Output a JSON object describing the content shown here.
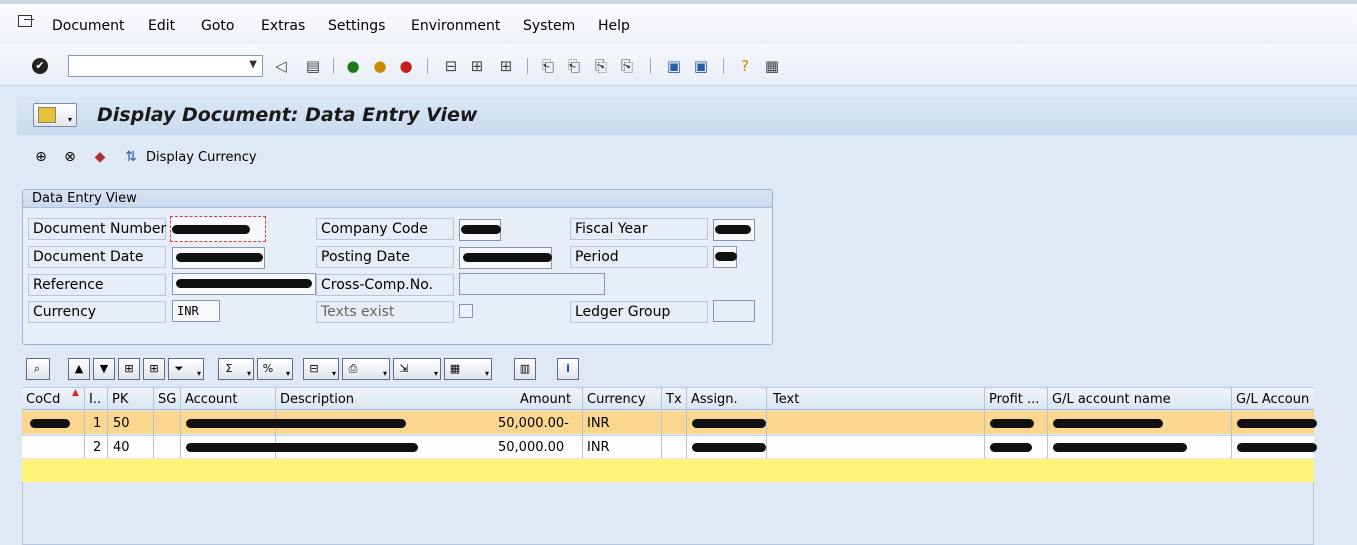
{
  "menu": {
    "items": [
      {
        "label": "Document"
      },
      {
        "label": "Edit"
      },
      {
        "label": "Goto"
      },
      {
        "label": "Extras"
      },
      {
        "label": "Settings"
      },
      {
        "label": "Environment"
      },
      {
        "label": "System"
      },
      {
        "label": "Help"
      }
    ]
  },
  "command_field": {
    "value": ""
  },
  "page": {
    "title": "Display Document: Data Entry View"
  },
  "app_toolbar": {
    "display_currency_label": "Display Currency"
  },
  "groupbox": {
    "title": "Data Entry View",
    "document_number_label": "Document Number",
    "document_date_label": "Document Date",
    "reference_label": "Reference",
    "currency_label": "Currency",
    "currency_value": "INR",
    "company_code_label": "Company Code",
    "posting_date_label": "Posting Date",
    "cross_comp_label": "Cross-Comp.No.",
    "texts_exist_label": "Texts exist",
    "fiscal_year_label": "Fiscal Year",
    "period_label": "Period",
    "ledger_group_label": "Ledger Group"
  },
  "grid": {
    "columns": [
      "CoCd",
      "I..",
      "PK",
      "SG",
      "Account",
      "Description",
      "Amount",
      "Currency",
      "Tx",
      "Assign.",
      "Text",
      "Profit ...",
      "G/L account name",
      "G/L Accoun"
    ],
    "rows": [
      {
        "item": "1",
        "pk": "50",
        "amount": "50,000.00-",
        "currency": "INR"
      },
      {
        "item": "2",
        "pk": "40",
        "amount": "50,000.00",
        "currency": "INR"
      }
    ]
  },
  "colors": {
    "selected_row": "#fbd68e",
    "total_row": "#fff37a",
    "background": "#dfe9f5"
  }
}
